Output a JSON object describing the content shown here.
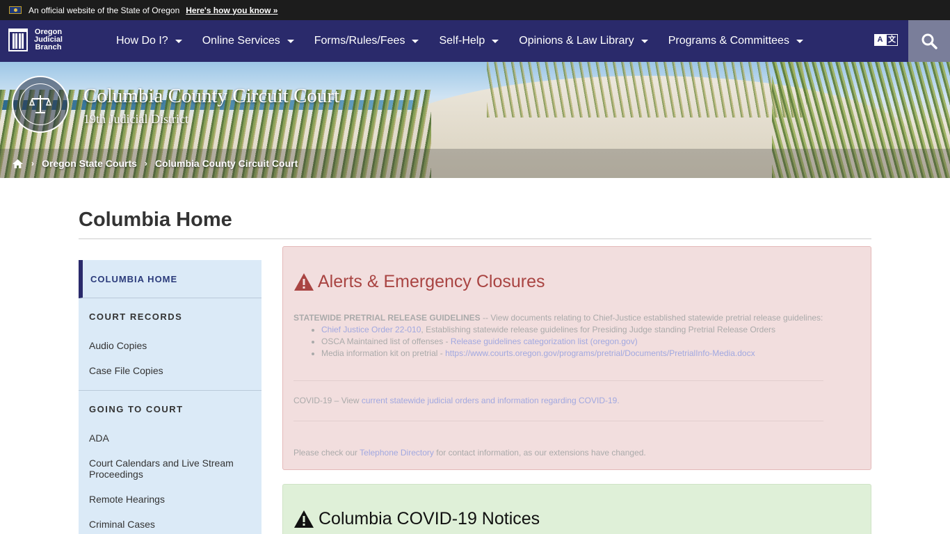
{
  "official_bar": {
    "text": "An official website of the State of Oregon",
    "link": "Here's how you know »"
  },
  "nav": {
    "logo_lines": [
      "Oregon",
      "Judicial",
      "Branch"
    ],
    "items": [
      {
        "label": "How Do I?"
      },
      {
        "label": "Online Services"
      },
      {
        "label": "Forms/Rules/Fees"
      },
      {
        "label": "Self-Help"
      },
      {
        "label": "Opinions & Law Library"
      },
      {
        "label": "Programs & Committees"
      }
    ],
    "translate_icon": "translate-icon",
    "search_icon": "search-icon"
  },
  "banner": {
    "title": "Columbia County Circuit Court",
    "subtitle": "19th Judicial District",
    "seal_icon": "judicial-seal-icon",
    "breadcrumb": [
      "Oregon State Courts",
      "Columbia County Circuit Court"
    ]
  },
  "page": {
    "title": "Columbia Home"
  },
  "sidebar": {
    "active": "COLUMBIA HOME",
    "sections": [
      {
        "heading": "COURT RECORDS",
        "links": [
          "Audio Copies",
          "Case File Copies"
        ]
      },
      {
        "heading": "GOING TO COURT",
        "links": [
          "ADA",
          "Court Calendars and Live Stream Proceedings",
          "Remote Hearings",
          "Criminal Cases"
        ]
      }
    ]
  },
  "alert": {
    "title": "Alerts & Emergency Closures",
    "lead": "STATEWIDE PRETRIAL RELEASE GUIDELINES",
    "lead_rest": " -- View documents relating to Chief-Justice established statewide pretrial release guidelines:",
    "items": [
      {
        "link": "Chief Justice Order 22-010",
        "text": ", Establishing statewide release guidelines for Presiding Judge standing Pretrial Release Orders"
      },
      {
        "pre": "OSCA Maintained list of offenses - ",
        "link": "Release guidelines categorization list (oregon.gov)"
      },
      {
        "pre": "Media information kit on pretrial - ",
        "link": "https://www.courts.oregon.gov/programs/pretrial/Documents/PretrialInfo-Media.docx"
      }
    ],
    "covid_pre": "COVID-19 – View ",
    "covid_link": "current statewide judicial orders and information regarding COVID-19.",
    "phone_pre": "Please check our ",
    "phone_link": "Telephone Directory",
    "phone_post": " for contact information, as our extensions have changed."
  },
  "covid_panel": {
    "title": "Columbia COVID-19 Notices"
  },
  "colors": {
    "nav_bg": "#2a2a6b",
    "alert_bg": "#f2dede",
    "alert_title": "#a94442",
    "covid_bg": "#dff0d8",
    "sidebar_bg": "#dbeaf7"
  }
}
